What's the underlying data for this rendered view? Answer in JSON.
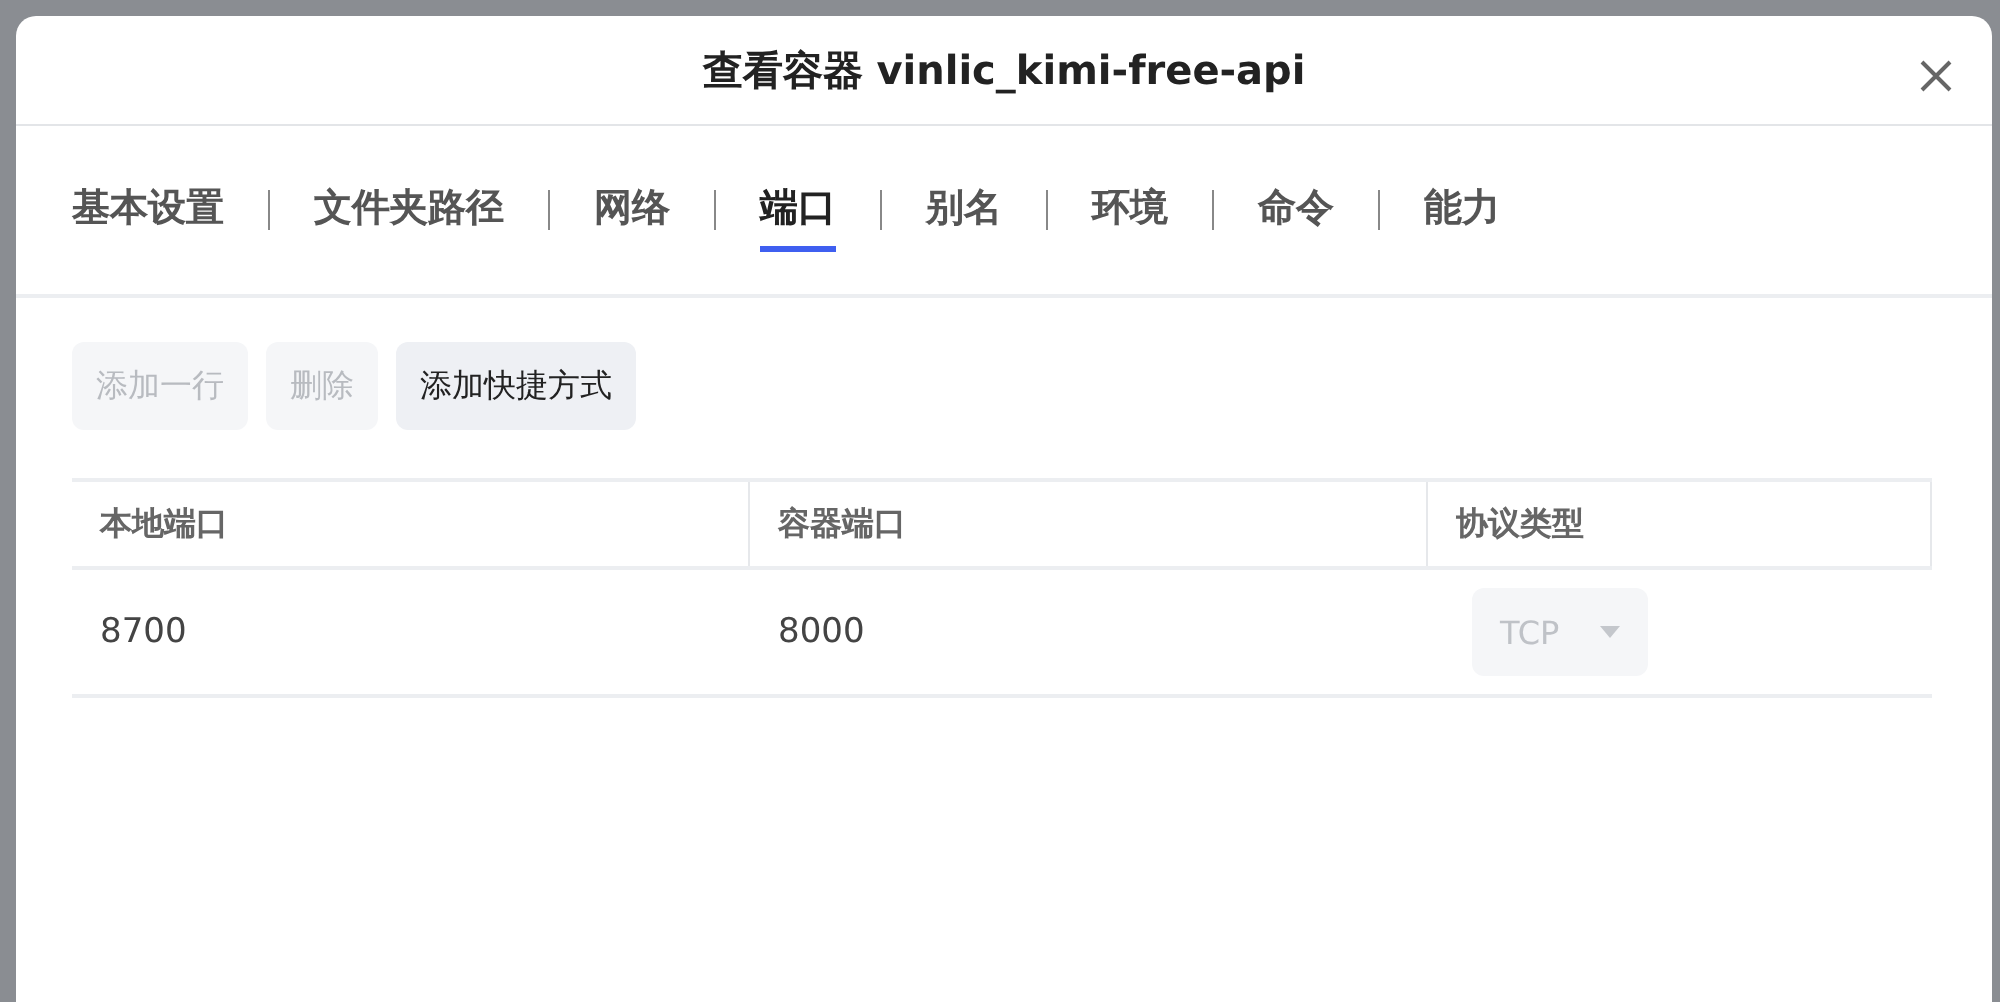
{
  "dialog": {
    "title": "查看容器 vinlic_kimi-free-api"
  },
  "tabs": [
    {
      "label": "基本设置",
      "selected": false
    },
    {
      "label": "文件夹路径",
      "selected": false
    },
    {
      "label": "网络",
      "selected": false
    },
    {
      "label": "端口",
      "selected": true
    },
    {
      "label": "别名",
      "selected": false
    },
    {
      "label": "环境",
      "selected": false
    },
    {
      "label": "命令",
      "selected": false
    },
    {
      "label": "能力",
      "selected": false
    }
  ],
  "toolbar": [
    {
      "label": "添加一行",
      "disabled": true
    },
    {
      "label": "删除",
      "disabled": true
    },
    {
      "label": "添加快捷方式",
      "disabled": false
    }
  ],
  "table": {
    "columns": [
      "本地端口",
      "容器端口",
      "协议类型"
    ],
    "rows": [
      {
        "local_port": "8700",
        "container_port": "8000",
        "protocol": {
          "value": "TCP",
          "disabled": true
        }
      }
    ]
  }
}
